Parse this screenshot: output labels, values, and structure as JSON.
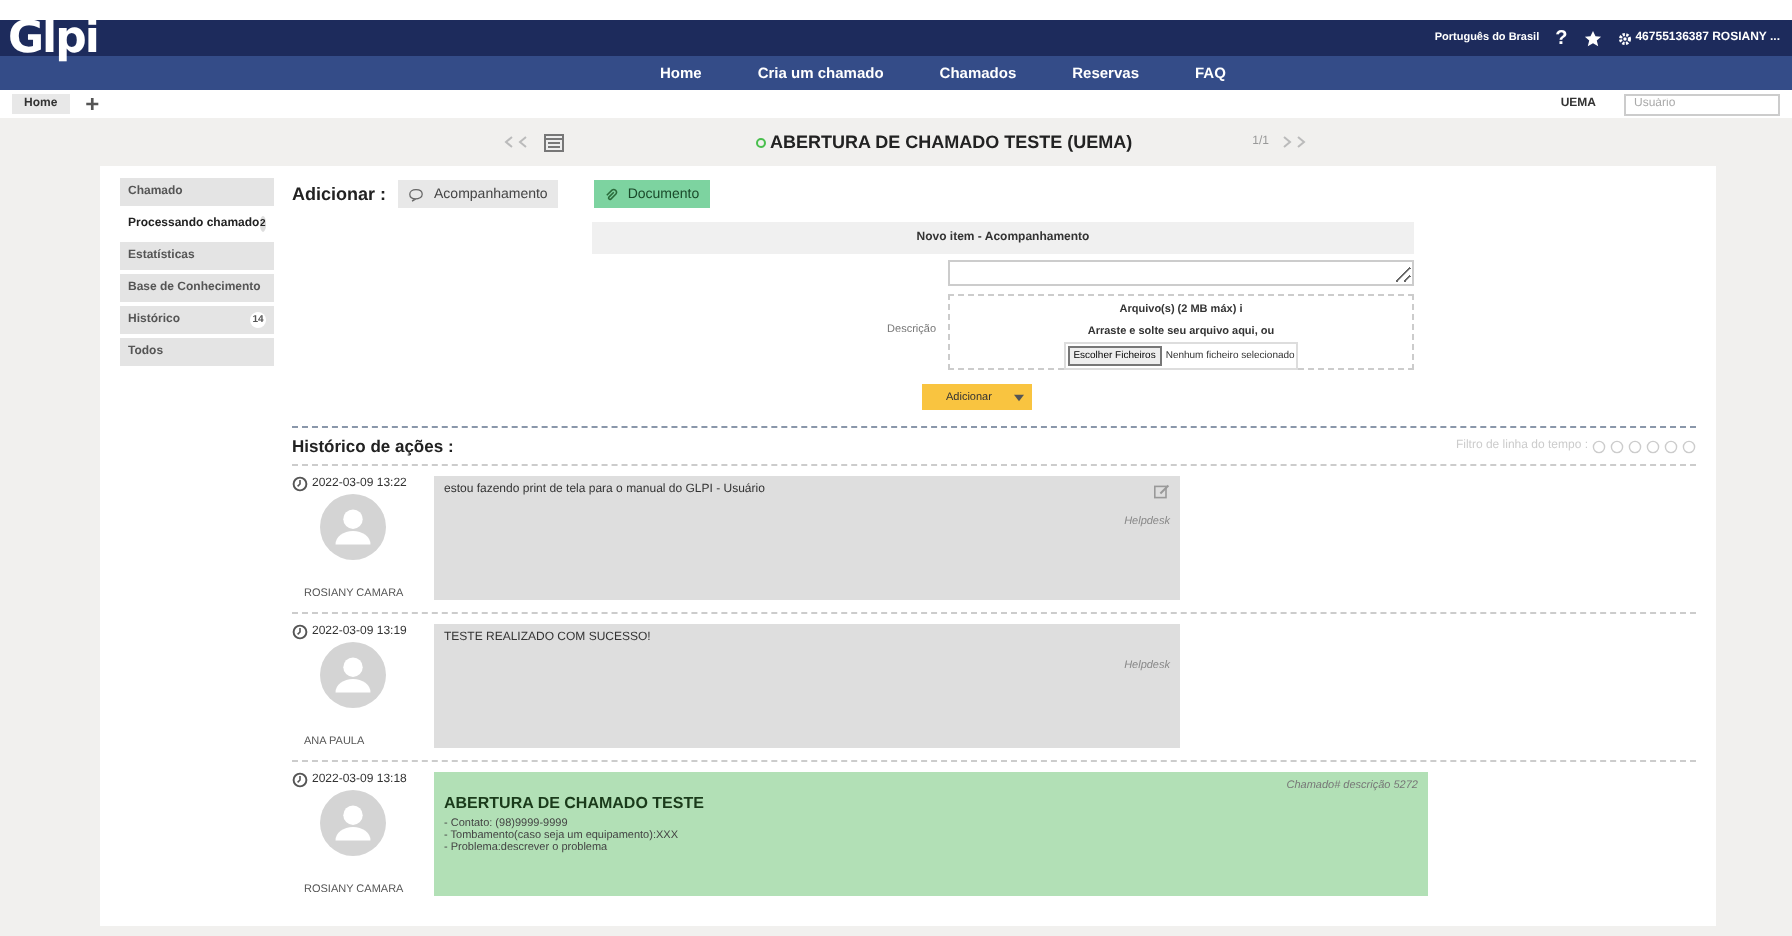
{
  "header": {
    "logo": "Glpi",
    "language": "Português do Brasil",
    "help": "?",
    "user": "46755136387 ROSIANY ..."
  },
  "nav": [
    "Home",
    "Cria um chamado",
    "Chamados",
    "Reservas",
    "FAQ"
  ],
  "breadcrumb": {
    "home": "Home",
    "add": "+",
    "entity": "UEMA",
    "search_placeholder": "Usuário"
  },
  "ticket": {
    "title": "ABERTURA DE CHAMADO TESTE (UEMA)",
    "counter": "1/1"
  },
  "tabs": [
    {
      "label": "Chamado",
      "selected": false
    },
    {
      "label": "Processando chamado",
      "badge": "2",
      "selected": true
    },
    {
      "label": "Estatísticas",
      "selected": false
    },
    {
      "label": "Base de Conhecimento",
      "selected": false
    },
    {
      "label": "Histórico",
      "badge": "14",
      "selected": false
    },
    {
      "label": "Todos",
      "selected": false
    }
  ],
  "add": {
    "label": "Adicionar :",
    "buttons": [
      {
        "label": "Acompanhamento",
        "kind": "followup"
      },
      {
        "label": "Documento",
        "kind": "document"
      }
    ]
  },
  "form": {
    "header": "Novo item - Acompanhamento",
    "description_label": "Descrição",
    "files_title": "Arquivo(s) (2 MB máx)",
    "files_info": "i",
    "drop_text": "Arraste e solte seu arquivo aqui, ou",
    "choose": "Escolher Ficheiros",
    "no_file": "Nenhum ficheiro selecionado",
    "submit": "Adicionar"
  },
  "history": {
    "title": "Histórico de ações :",
    "filter_label": "Filtro de linha do tempo :",
    "entries": [
      {
        "date": "2022-03-09 13:22",
        "author": "ROSIANY CAMARA",
        "kind": "followup",
        "text": "estou fazendo print de tela para o manual do GLPI - Usuário",
        "source": "Helpdesk",
        "editable": true
      },
      {
        "date": "2022-03-09 13:19",
        "author": "ANA PAULA",
        "kind": "followup",
        "text": "TESTE REALIZADO COM SUCESSO!",
        "source": "Helpdesk",
        "editable": false
      },
      {
        "date": "2022-03-09 13:18",
        "author": "ROSIANY CAMARA",
        "kind": "description",
        "heading": "ABERTURA DE CHAMADO TESTE",
        "ref": "Chamado# descrição 5272",
        "lines": [
          "- Contato: (98)9999-9999",
          "- Tombamento(caso seja um equipamento):XXX",
          "- Problema:descrever o problema"
        ]
      }
    ]
  }
}
